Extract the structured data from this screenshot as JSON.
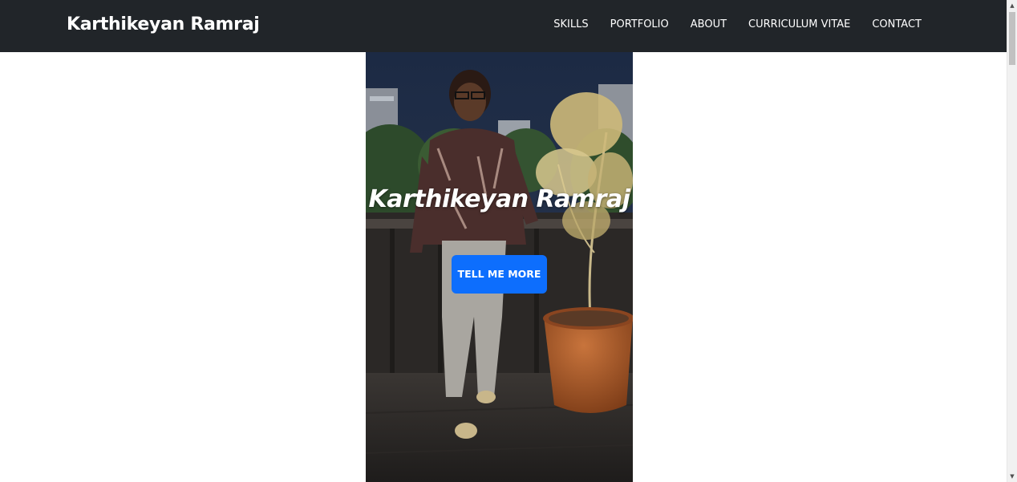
{
  "navbar": {
    "brand": "Karthikeyan Ramraj",
    "links": [
      {
        "label": "SKILLS"
      },
      {
        "label": "PORTFOLIO"
      },
      {
        "label": "ABOUT"
      },
      {
        "label": "CURRICULUM VITAE"
      },
      {
        "label": "CONTACT"
      }
    ],
    "background_color": "#212529"
  },
  "hero": {
    "title": "Karthikeyan Ramraj",
    "button_label": "TELL ME MORE",
    "button_color": "#0d6efd"
  },
  "scrollbar": {
    "up_icon": "triangle-up-icon",
    "down_icon": "triangle-down-icon"
  }
}
